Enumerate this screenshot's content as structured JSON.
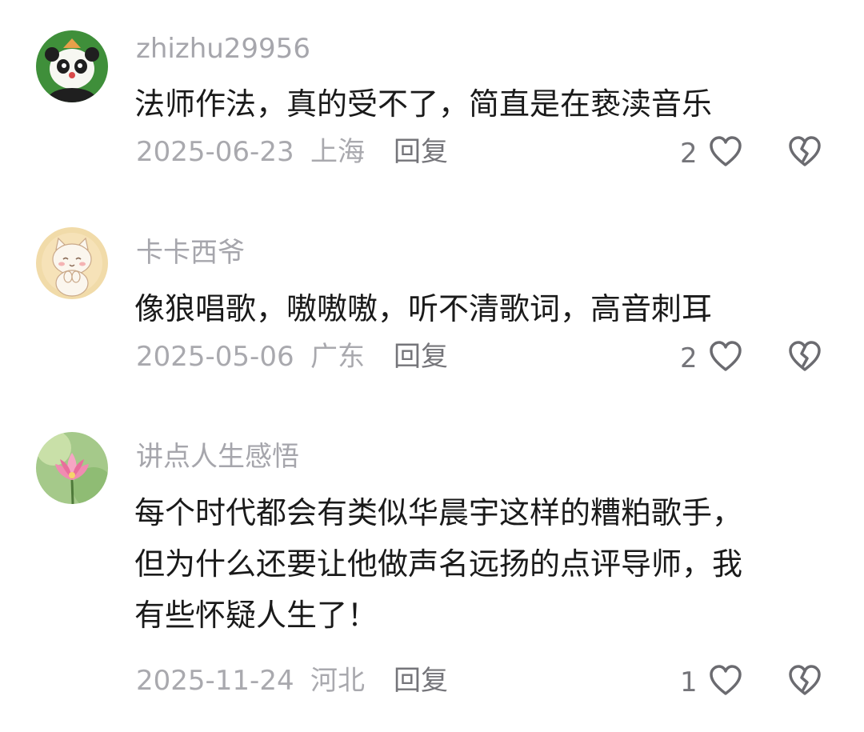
{
  "comments": [
    {
      "username": "zhizhu29956",
      "avatar": "panda-avatar",
      "content": "法师作法，真的受不了，简直是在亵渎音乐",
      "date": "2025-06-23",
      "location": "上海",
      "reply_label": "回复",
      "likes": "2"
    },
    {
      "username": "卡卡西爷",
      "avatar": "cat-avatar",
      "content": "像狼唱歌，嗷嗷嗷，听不清歌词，高音刺耳",
      "date": "2025-05-06",
      "location": "广东",
      "reply_label": "回复",
      "likes": "2"
    },
    {
      "username": "讲点人生感悟",
      "avatar": "lotus-avatar",
      "content_lines": [
        "每个时代都会有类似华晨宇这样的糟粕歌手，",
        "但为什么还要让他做声名远扬的点评导师，我",
        "有些怀疑人生了！"
      ],
      "date": "2025-11-24",
      "location": "河北",
      "reply_label": "回复",
      "likes": "1"
    }
  ],
  "icons": {
    "like": "heart-outline-icon",
    "dislike": "broken-heart-icon"
  },
  "colors": {
    "meta_text": "#a9a9ae",
    "reply_text": "#75757a",
    "body_text": "#1a1a1a",
    "icon_stroke": "#6b6b70"
  }
}
